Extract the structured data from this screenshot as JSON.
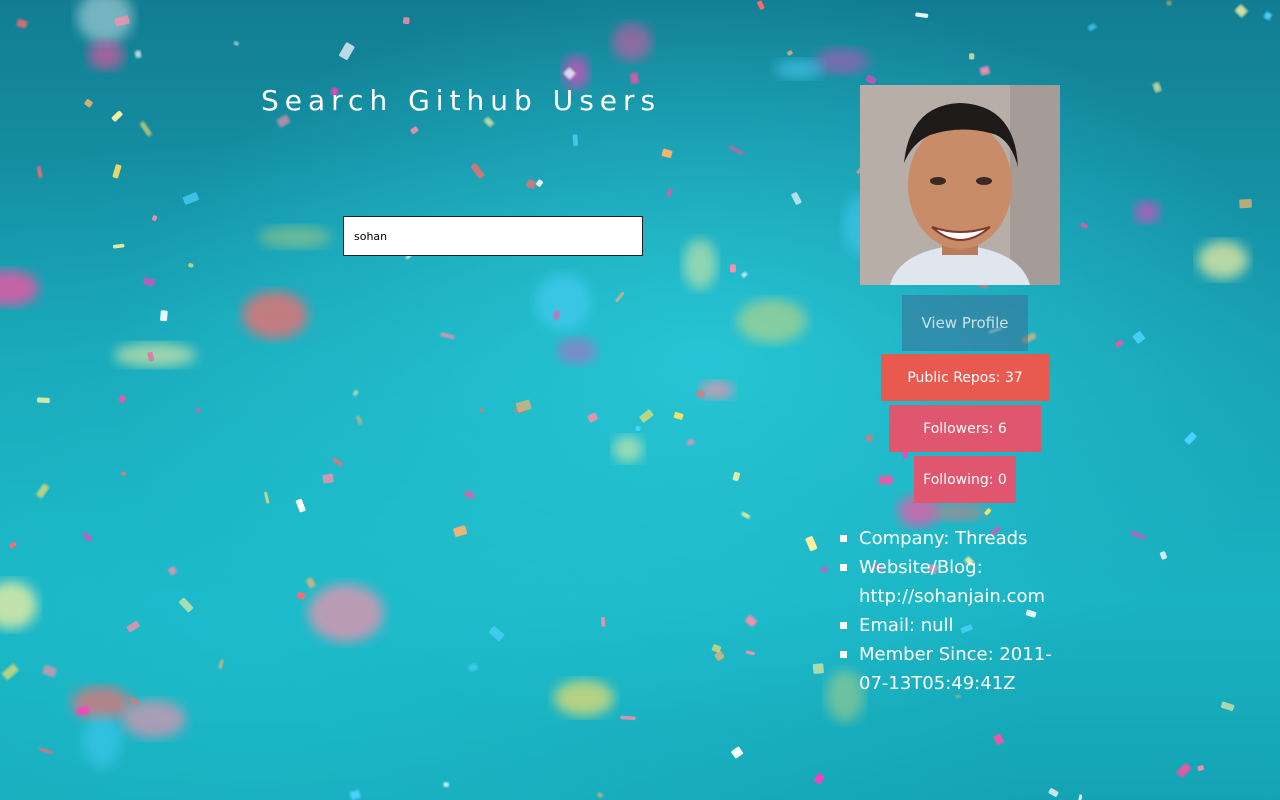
{
  "title": "Search Github Users",
  "search": {
    "value": "sohan"
  },
  "profile": {
    "avatar_alt": "user avatar",
    "view_profile_label": "View Profile",
    "public_repos_label": "Public Repos: 37",
    "followers_label": "Followers: 6",
    "following_label": "Following: 0",
    "details": [
      "Company: Threads",
      "Website/Blog: http://sohanjain.com",
      "Email: null",
      "Member Since: 2011-07-13T05:49:41Z"
    ]
  },
  "colors": {
    "background": "#17a2b4",
    "repos_button": "#e85a4f",
    "followers_button": "#e0566f",
    "view_profile_button": "#3c6e96"
  },
  "icons": [
    "confetti-background"
  ]
}
